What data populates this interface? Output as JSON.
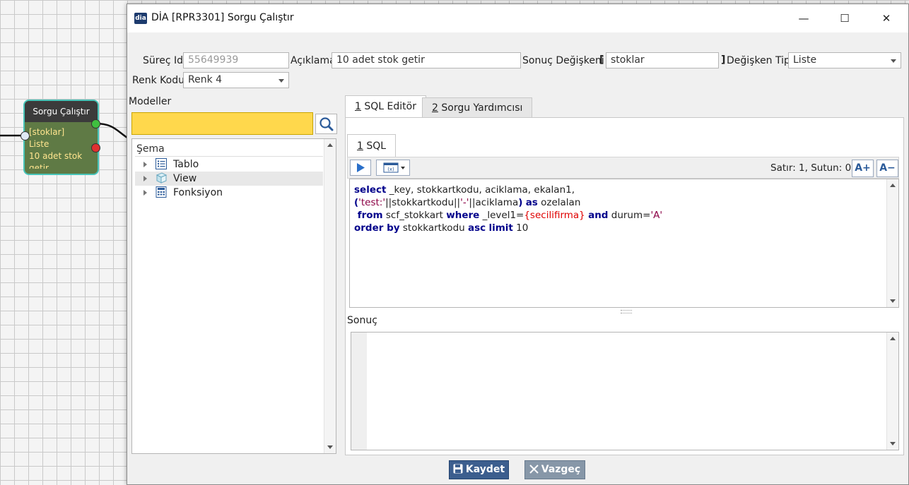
{
  "canvas": {
    "node": {
      "title": "Sorgu Çalıştır",
      "lines": [
        "[stoklar]",
        "Liste",
        "10 adet stok",
        "getir"
      ]
    }
  },
  "window": {
    "app_logo": "dia",
    "title": "DİA [RPR3301] Sorgu Çalıştır",
    "controls": {
      "minimize": "—",
      "maximize": "☐",
      "close": "✕"
    }
  },
  "form": {
    "surec_id_label": "Süreç Id",
    "surec_id_value": "55649939",
    "aciklama_label": "Açıklama",
    "aciklama_value": "10 adet stok getir",
    "sonuc_degiskeni_label": "Sonuç Değişkeni",
    "bracket_open": "[",
    "bracket_close": "]",
    "sonuc_degiskeni_value": "stoklar",
    "degisken_tipi_label": "Değişken Tipi",
    "degisken_tipi_value": "Liste",
    "renk_kodu_label": "Renk Kodu",
    "renk_kodu_value": "Renk 4"
  },
  "models": {
    "label": "Modeller",
    "search_value": "",
    "tree_root": "Şema",
    "items": [
      {
        "label": "Tablo",
        "icon": "list-icon"
      },
      {
        "label": "View",
        "icon": "view-cube-icon"
      },
      {
        "label": "Fonksiyon",
        "icon": "calculator-icon"
      }
    ]
  },
  "tabs": {
    "main": [
      {
        "num": "1",
        "label": "SQL Editör"
      },
      {
        "num": "2",
        "label": "Sorgu Yardımcısı"
      }
    ],
    "sub": [
      {
        "num": "1",
        "label": "SQL"
      }
    ]
  },
  "editor": {
    "status": "Satır: 1, Sutun: 0",
    "font_increase": "A+",
    "font_decrease": "A−",
    "code_lines": [
      [
        {
          "t": "select",
          "c": "kw"
        },
        {
          "t": " _key, stokkartkodu, aciklama, ekalan1,",
          "c": ""
        }
      ],
      [
        {
          "t": "(",
          "c": "kw"
        },
        {
          "t": "'test:'",
          "c": "str"
        },
        {
          "t": "||stokkartkodu||",
          "c": ""
        },
        {
          "t": "'-'",
          "c": "str"
        },
        {
          "t": "||aciklama",
          "c": ""
        },
        {
          "t": ")",
          "c": "kw"
        },
        {
          "t": " ",
          "c": ""
        },
        {
          "t": "as",
          "c": "kw"
        },
        {
          "t": " ozelalan",
          "c": ""
        }
      ],
      [
        {
          "t": " from",
          "c": "kw"
        },
        {
          "t": " scf_stokkart ",
          "c": ""
        },
        {
          "t": "where",
          "c": "kw"
        },
        {
          "t": " _level1=",
          "c": ""
        },
        {
          "t": "{secilifirma}",
          "c": "var"
        },
        {
          "t": " ",
          "c": ""
        },
        {
          "t": "and",
          "c": "kw"
        },
        {
          "t": " durum=",
          "c": ""
        },
        {
          "t": "'A'",
          "c": "str"
        }
      ],
      [
        {
          "t": "order by",
          "c": "kw"
        },
        {
          "t": " stokkartkodu ",
          "c": ""
        },
        {
          "t": "asc",
          "c": "kw"
        },
        {
          "t": " ",
          "c": ""
        },
        {
          "t": "limit",
          "c": "kw"
        },
        {
          "t": " 10",
          "c": ""
        }
      ]
    ]
  },
  "result": {
    "label": "Sonuç"
  },
  "buttons": {
    "save": "Kaydet",
    "cancel": "Vazgeç"
  },
  "colors": {
    "search_highlight": "#ffd84c",
    "save_button": "#3c5e8e",
    "cancel_button": "#8797a8",
    "sql_keyword": "#00008b",
    "sql_string": "#8b0044",
    "sql_variable": "#e00000"
  }
}
